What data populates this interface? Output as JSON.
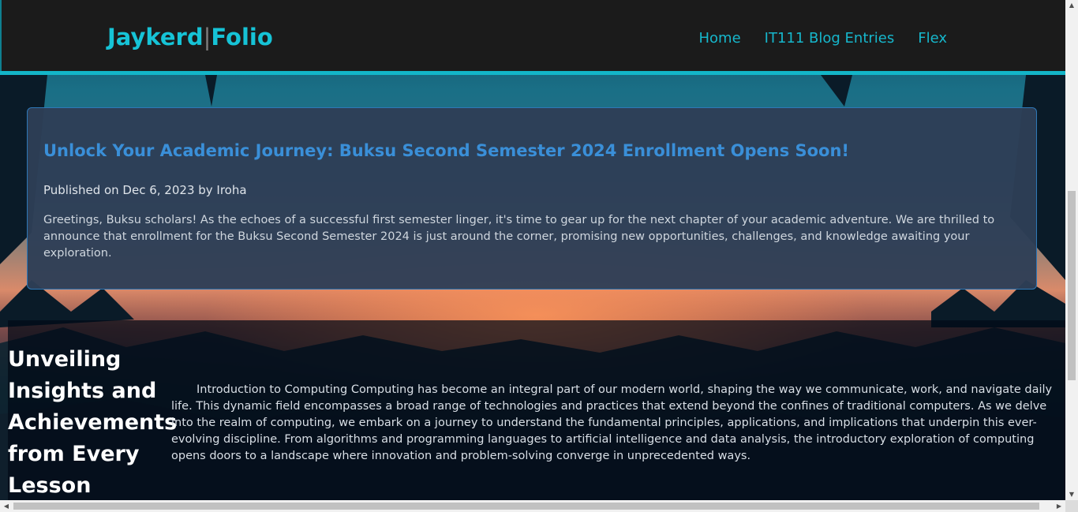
{
  "header": {
    "brand_left": "Jaykerd",
    "brand_sep": "|",
    "brand_right": "Folio",
    "nav": [
      "Home",
      "IT111 Blog Entries",
      "Flex"
    ]
  },
  "post": {
    "title": "Unlock Your Academic Journey: Buksu Second Semester 2024 Enrollment Opens Soon!",
    "meta": "Published on Dec 6, 2023 by Iroha",
    "body": "Greetings, Buksu scholars! As the echoes of a successful first semester linger, it's time to gear up for the next chapter of your academic adventure. We are thrilled to announce that enrollment for the Buksu Second Semester 2024 is just around the corner, promising new opportunities, challenges, and knowledge awaiting your exploration."
  },
  "section": {
    "title": "Unveiling Insights and Achievements from Every Lesson",
    "text": "Introduction to Computing Computing has become an integral part of our modern world, shaping the way we communicate, work, and navigate daily life. This dynamic field encompasses a broad range of technologies and practices that extend beyond the confines of traditional computers. As we delve into the realm of computing, we embark on a journey to understand the fundamental principles, applications, and implications that underpin this ever-evolving discipline. From algorithms and programming languages to artificial intelligence and data analysis, the introductory exploration of computing opens doors to a landscape where innovation and problem-solving converge in unprecedented ways."
  },
  "colors": {
    "accent": "#16c3d6",
    "navbar_bg": "#1b1b1b",
    "post_title": "#3a8fd8"
  }
}
